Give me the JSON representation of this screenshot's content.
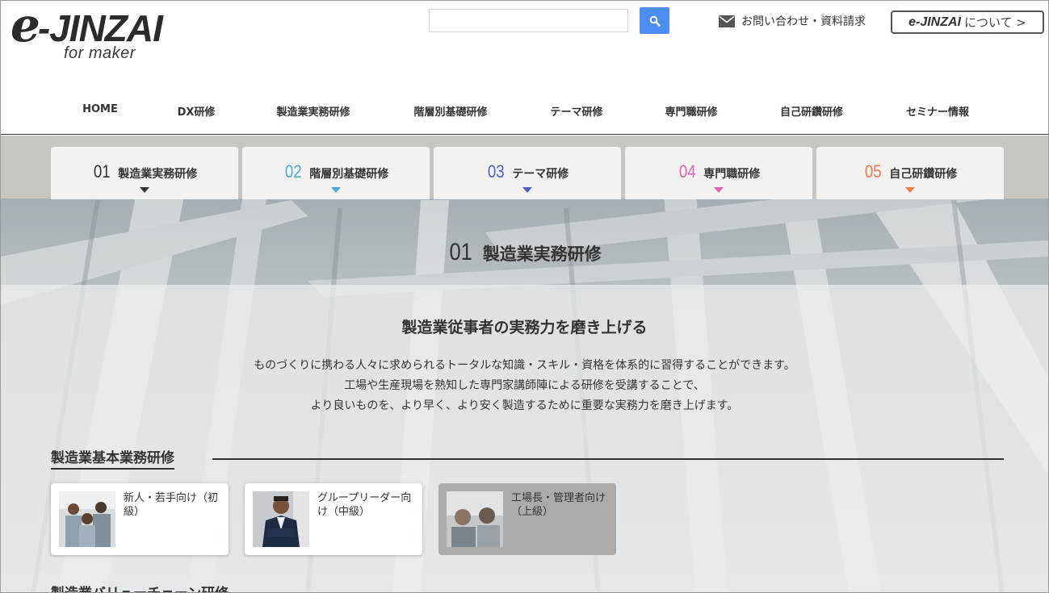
{
  "brand": {
    "logo_main": "-JINZAI",
    "logo_e": "e",
    "logo_sub": "for maker"
  },
  "header": {
    "search_placeholder": "",
    "contact_label": "お問い合わせ・資料請求",
    "about_brand": "e-JINZAI",
    "about_label": "について >"
  },
  "nav": {
    "items": [
      {
        "label": "HOME"
      },
      {
        "label": "DX研修"
      },
      {
        "label": "製造業実務研修"
      },
      {
        "label": "階層別基礎研修"
      },
      {
        "label": "テーマ研修"
      },
      {
        "label": "専門職研修"
      },
      {
        "label": "自己研鑽研修"
      },
      {
        "label": "セミナー情報"
      }
    ]
  },
  "tabs": [
    {
      "num": "01",
      "label": "製造業実務研修",
      "color": "#333333"
    },
    {
      "num": "02",
      "label": "階層別基礎研修",
      "color": "#4aa8dd"
    },
    {
      "num": "03",
      "label": "テーマ研修",
      "color": "#4b5fc4"
    },
    {
      "num": "04",
      "label": "専門職研修",
      "color": "#e062b0"
    },
    {
      "num": "05",
      "label": "自己研鑽研修",
      "color": "#ee7b4a"
    }
  ],
  "section": {
    "num": "01",
    "title": "製造業実務研修",
    "lead": "製造業従事者の実務力を磨き上げる",
    "desc_lines": [
      "ものづくりに携わる人々に求められるトータルな知識・スキル・資格を体系的に習得することができます。",
      "工場や生産現場を熟知した専門家講師陣による研修を受講することで、",
      "より良いものを、より早く、より安く製造するために重要な実務力を磨き上げます。"
    ]
  },
  "category": {
    "heading": "製造業基本業務研修",
    "cards": [
      {
        "label": "新人・若手向け（初級）",
        "icon": "team-photo"
      },
      {
        "label": "グループリーダー向け（中級）",
        "icon": "leader-photo"
      },
      {
        "label": "工場長・管理者向け（上級）",
        "icon": "manager-photo"
      }
    ]
  },
  "next_heading": "製造業バリューチェーン研修",
  "colors": {
    "accent_blue": "#4b8ef0",
    "tab_band": "#c9c6c1"
  }
}
